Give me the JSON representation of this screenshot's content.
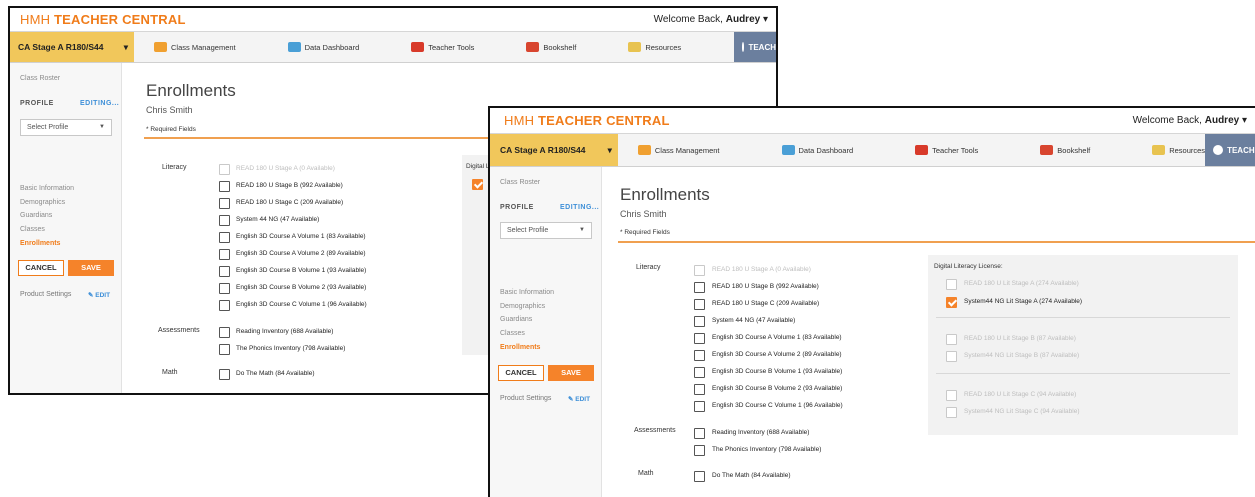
{
  "app": {
    "logo_thin": "HMH ",
    "logo_bold": "TEACHER CENTRAL",
    "welcome": "Welcome Back,",
    "user": "Audrey"
  },
  "nav": {
    "stage1": "CA Stage A R180/S44",
    "stage2": "CA Stage A R180/S44",
    "items": [
      "Class Management",
      "Data Dashboard",
      "Teacher Tools",
      "Bookshelf",
      "Resources"
    ],
    "teach": "TEACH",
    "colors": {
      "class": "#f0a030",
      "data": "#4a9fd6",
      "tools": "#d83a2a",
      "book": "#d8452f",
      "res": "#e8c350"
    }
  },
  "sidebar": {
    "roster": "Class Roster",
    "profile": "PROFILE",
    "editing": "EDITING...",
    "select": "Select Profile",
    "links": [
      "Basic Information",
      "Demographics",
      "Guardians",
      "Classes",
      "Enrollments"
    ],
    "cancel": "CANCEL",
    "save": "SAVE",
    "product_settings": "Product Settings",
    "edit": "EDIT"
  },
  "page": {
    "title": "Enrollments",
    "student": "Chris Smith",
    "required": "* Required Fields"
  },
  "sections": {
    "literacy": "Literacy",
    "assessments": "Assessments",
    "math": "Math",
    "digital1": "Digital Lit",
    "digital2": "Digital Literacy License:"
  },
  "literacy_options": [
    "READ 180 U Stage A (0 Available)",
    "READ 180 U Stage B (992 Available)",
    "READ 180 U Stage C (209 Available)",
    "System 44 NG (47 Available)",
    "English 3D Course A Volume 1 (83 Available)",
    "English 3D Course A Volume 2 (89 Available)",
    "English 3D Course B Volume 1 (93 Available)",
    "English 3D Course B Volume 2 (93 Available)",
    "English 3D Course C Volume 1 (96 Available)"
  ],
  "assessment_options": [
    "Reading Inventory (688 Available)",
    "The Phonics Inventory (798 Available)"
  ],
  "math_options": [
    "Do The Math (84 Available)"
  ],
  "digital_options": [
    "READ 180 U Lit Stage A (274 Available)",
    "System44 NG Lit Stage A (274 Available)",
    "READ 180 U Lit Stage B (87 Available)",
    "System44 NG Lit Stage B (87 Available)",
    "READ 180 U Lit Stage C (94 Available)",
    "System44 NG Lit Stage C (94 Available)"
  ]
}
